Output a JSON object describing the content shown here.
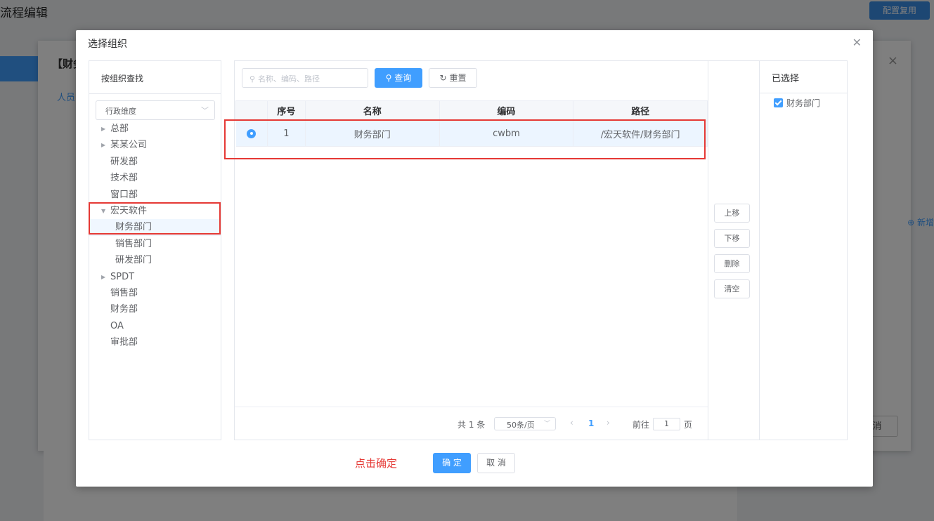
{
  "background": {
    "page_title": "流程编辑",
    "reuse_button": "配置复用",
    "panel_title": "【财务",
    "panel_tab": "人员",
    "panel_cancel": "消",
    "right_link": "新增"
  },
  "dialog": {
    "title": "选择组织"
  },
  "tree_panel": {
    "header": "按组织查找",
    "dimension": "行政维度",
    "nodes": [
      {
        "label": "总部",
        "level": 0,
        "expandable": true
      },
      {
        "label": "某某公司",
        "level": 0,
        "expandable": true
      },
      {
        "label": "研发部",
        "level": 0,
        "expandable": false
      },
      {
        "label": "技术部",
        "level": 0,
        "expandable": false
      },
      {
        "label": "窗口部",
        "level": 0,
        "expandable": false
      },
      {
        "label": "宏天软件",
        "level": 0,
        "expandable": true,
        "expanded": true
      },
      {
        "label": "财务部门",
        "level": 1,
        "expandable": false,
        "current": true
      },
      {
        "label": "销售部门",
        "level": 1,
        "expandable": false
      },
      {
        "label": "研发部门",
        "level": 1,
        "expandable": false
      },
      {
        "label": "SPDT",
        "level": 0,
        "expandable": true
      },
      {
        "label": "销售部",
        "level": 0,
        "expandable": false
      },
      {
        "label": "财务部",
        "level": 0,
        "expandable": false
      },
      {
        "label": "OA",
        "level": 0,
        "expandable": false
      },
      {
        "label": "审批部",
        "level": 0,
        "expandable": false
      }
    ]
  },
  "search": {
    "placeholder": "名称、编码、路径",
    "query_label": "查询",
    "reset_label": "重置"
  },
  "table": {
    "columns": [
      "",
      "序号",
      "名称",
      "编码",
      "路径"
    ],
    "rows": [
      {
        "selected": true,
        "index": "1",
        "name": "财务部门",
        "code": "cwbm",
        "path": "/宏天软件/财务部门"
      }
    ]
  },
  "pager": {
    "total": "共 1 条",
    "page_size": "50条/页",
    "current_page": "1",
    "goto_label": "前往",
    "goto_value": "1",
    "goto_unit": "页"
  },
  "move_buttons": {
    "up": "上移",
    "down": "下移",
    "delete": "删除",
    "clear": "清空"
  },
  "selected_panel": {
    "header": "已选择",
    "items": [
      "财务部门"
    ]
  },
  "footer": {
    "hint": "点击确定",
    "ok_label": "确 定",
    "cancel_label": "取 消"
  },
  "colors": {
    "primary": "#409eff",
    "annotation_red": "#e53935"
  }
}
